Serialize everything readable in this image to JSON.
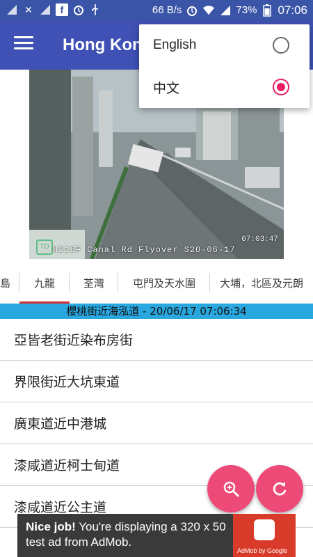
{
  "status_bar": {
    "net_speed": "66 B/s",
    "battery": "73%",
    "time": "07:06"
  },
  "app_bar": {
    "title": "Hong Kong Traffic Cams"
  },
  "camera": {
    "timestamp": "07:03:47",
    "caption": "H216F Canal Rd Flyover S20-06-17"
  },
  "tabs": [
    {
      "label": "島"
    },
    {
      "label": "九龍"
    },
    {
      "label": "荃灣"
    },
    {
      "label": "屯門及天水圍"
    },
    {
      "label": "大埔，北區及元朗"
    }
  ],
  "banner": {
    "text": "櫻桃街近海泓道 - 20/06/17 07:06:34"
  },
  "list": [
    {
      "label": "亞皆老街近染布房街"
    },
    {
      "label": "界限街近大坑東道"
    },
    {
      "label": "廣東道近中港城"
    },
    {
      "label": "漆咸道近柯士甸道"
    },
    {
      "label": "漆咸道近公主道"
    }
  ],
  "language_menu": {
    "options": [
      {
        "label": "English",
        "checked": false
      },
      {
        "label": "中文",
        "checked": true
      }
    ]
  },
  "ad": {
    "bold": "Nice job!",
    "text": " You're displaying a 320 x 50 test ad from AdMob.",
    "brand": "AdMob by Google"
  },
  "colors": {
    "app_bar": "#3f51b5",
    "accent": "#e91e63",
    "fab": "#ee4a78",
    "banner": "#29a7df",
    "tab_indicator": "#d32f2f"
  }
}
